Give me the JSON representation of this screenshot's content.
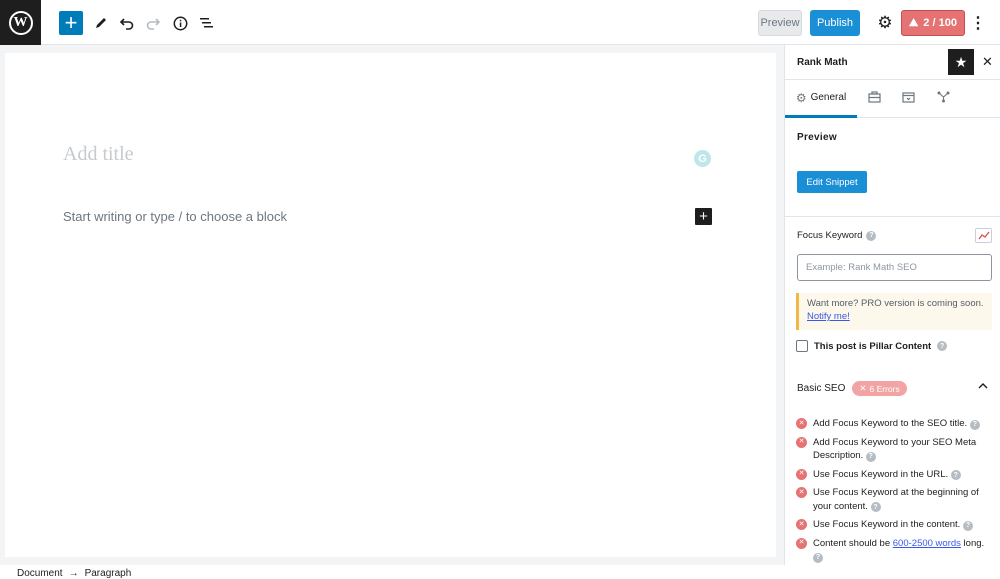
{
  "toolbar": {
    "preview_label": "Preview",
    "publish_label": "Publish",
    "score_label": "2 / 100"
  },
  "editor": {
    "title_placeholder": "Add title",
    "block_placeholder": "Start writing or type / to choose a block"
  },
  "breadcrumb": {
    "items": [
      "Document",
      "Paragraph"
    ],
    "separator": "→"
  },
  "sidebar": {
    "title": "Rank Math",
    "tabs": {
      "general_label": "General"
    },
    "preview_heading": "Preview",
    "edit_snippet_label": "Edit Snippet",
    "focus_keyword_label": "Focus Keyword",
    "focus_keyword_placeholder": "Example: Rank Math SEO",
    "pro_notice_text": "Want more? PRO version is coming soon.",
    "pro_notice_link": "Notify me!",
    "pillar_label": "This post is Pillar Content",
    "basic_seo_label": "Basic SEO",
    "errors_badge": "6 Errors",
    "checks": [
      {
        "text": "Add Focus Keyword to the SEO title."
      },
      {
        "text": "Add Focus Keyword to your SEO Meta Description."
      },
      {
        "text": "Use Focus Keyword in the URL."
      },
      {
        "text": "Use Focus Keyword at the beginning of your content."
      },
      {
        "text": "Use Focus Keyword in the content."
      },
      {
        "text": "Content should be",
        "link": "600-2500 words",
        "suffix": "long."
      }
    ]
  },
  "colors": {
    "accent": "#007cba",
    "publish": "#1a8fd6",
    "error": "#e57373",
    "notice_border": "#f0b849"
  },
  "icons": [
    "wordpress-logo",
    "plus-icon",
    "pencil-icon",
    "undo-icon",
    "redo-icon",
    "info-icon",
    "list-view-icon",
    "gear-icon",
    "more-vertical-icon",
    "star-icon",
    "close-icon",
    "grammarly-icon",
    "trend-icon",
    "chevron-up-icon",
    "error-x-icon",
    "help-icon"
  ]
}
